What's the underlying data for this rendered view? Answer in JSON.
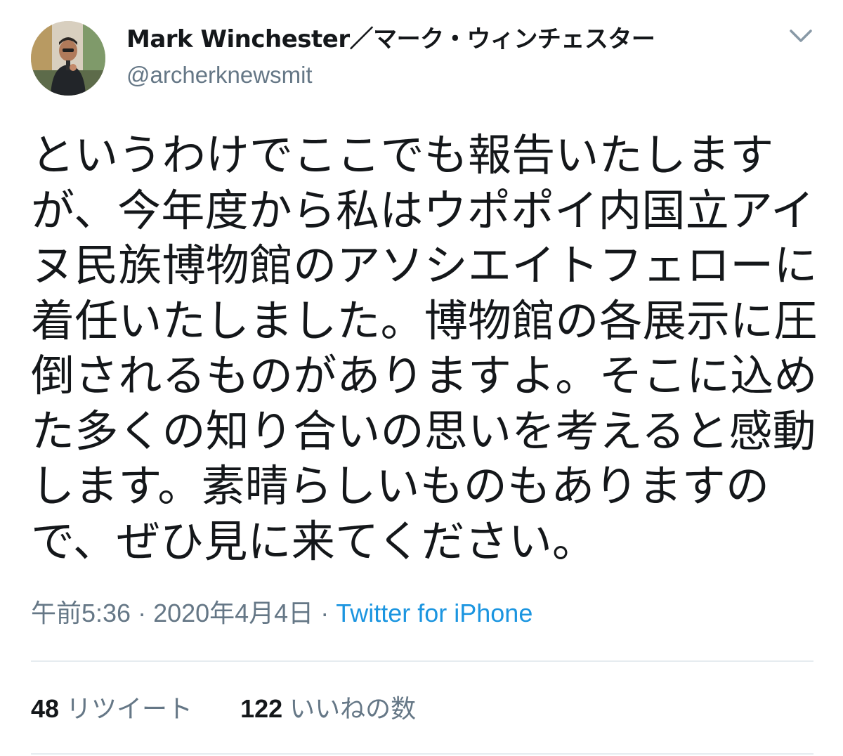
{
  "author": {
    "name": "Mark Winchester／マーク・ウィンチェスター",
    "handle": "@archerknewsmit",
    "avatar_icon": "profile-photo"
  },
  "menu_icon": "chevron-down-icon",
  "tweet_text_lines": [
    "というわけでここでも報告いたします",
    "が、今年度から私はウポポイ内国立アイ",
    "ヌ民族博物館のアソシエイトフェローに",
    "着任いたしました。博物館の各展示に圧",
    "倒されるものがありますよ。そこに込め",
    "た多くの知り合いの思いを考えると感動",
    "します。素晴らしいものもありますの",
    "で、ぜひ見に来てください。"
  ],
  "meta": {
    "time": "午前5:36",
    "separator": "·",
    "date": "2020年4月4日",
    "source": "Twitter for iPhone"
  },
  "stats": {
    "retweets_count": "48",
    "retweets_label": "リツイート",
    "likes_count": "122",
    "likes_label": "いいねの数"
  },
  "colors": {
    "text": "#14171a",
    "secondary": "#657786",
    "link": "#1b95e0",
    "divider": "#e6ecf0"
  }
}
